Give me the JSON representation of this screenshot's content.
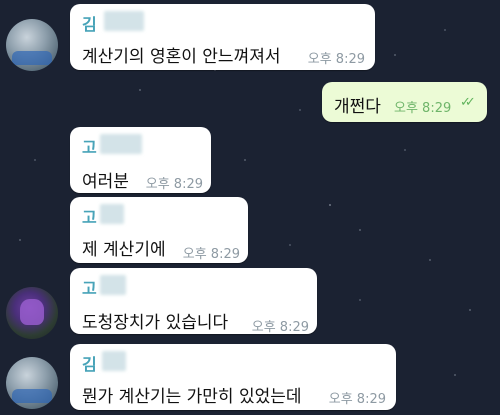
{
  "messages": [
    {
      "sender": "김",
      "text": "계산기의 영혼이 안느껴져서",
      "time": "오후 8:29"
    },
    {
      "text": "개쩐다",
      "time": "오후 8:29",
      "status_icon": "double-check-icon"
    },
    {
      "sender": "고",
      "text": "여러분",
      "time": "오후 8:29"
    },
    {
      "sender": "고",
      "text": "제 계산기에",
      "time": "오후 8:29"
    },
    {
      "sender": "고",
      "text": "도청장치가 있습니다",
      "time": "오후 8:29"
    },
    {
      "sender": "김",
      "text": "뭔가 계산기는 가만히 있었는데",
      "time": "오후 8:29"
    }
  ],
  "colors": {
    "background": "#1b2232",
    "incoming_bubble": "#ffffff",
    "outgoing_bubble": "#ecfbd6",
    "sender_name": "#47a3b8",
    "read_ticks": "#62b45e"
  }
}
